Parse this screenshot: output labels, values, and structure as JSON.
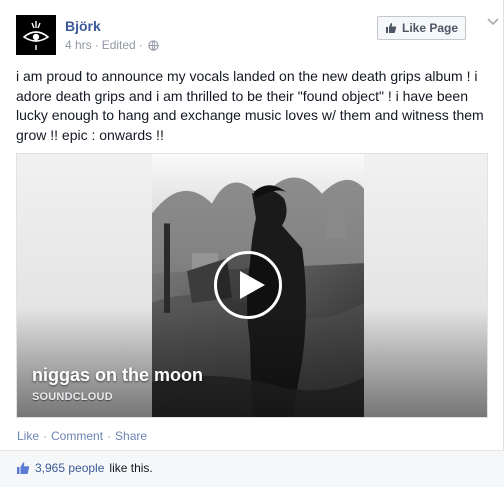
{
  "post": {
    "author": "Björk",
    "time": "4 hrs",
    "edited": "Edited",
    "dot": "·",
    "text": "i am proud to announce my vocals landed on the new death grips album ! i adore death grips and i am thrilled to be their \"found object\" ! i have been lucky enough to hang and exchange music loves w/ them and witness them grow !! epic : onwards !!"
  },
  "header": {
    "like_page_label": "Like Page"
  },
  "media": {
    "title": "niggas on the moon",
    "source": "SOUNDCLOUD"
  },
  "actions": {
    "like": "Like",
    "comment": "Comment",
    "share": "Share",
    "sep": "·"
  },
  "likes": {
    "count_people": "3,965 people",
    "suffix": "like this."
  },
  "colors": {
    "link": "#3b5998",
    "meta": "#9197a3",
    "text": "#141823"
  },
  "icons": {
    "avatar": "bjork-eye-logo",
    "globe": "globe-icon",
    "thumb": "thumbs-up-icon",
    "play": "play-icon",
    "chevron": "chevron-down-icon"
  }
}
